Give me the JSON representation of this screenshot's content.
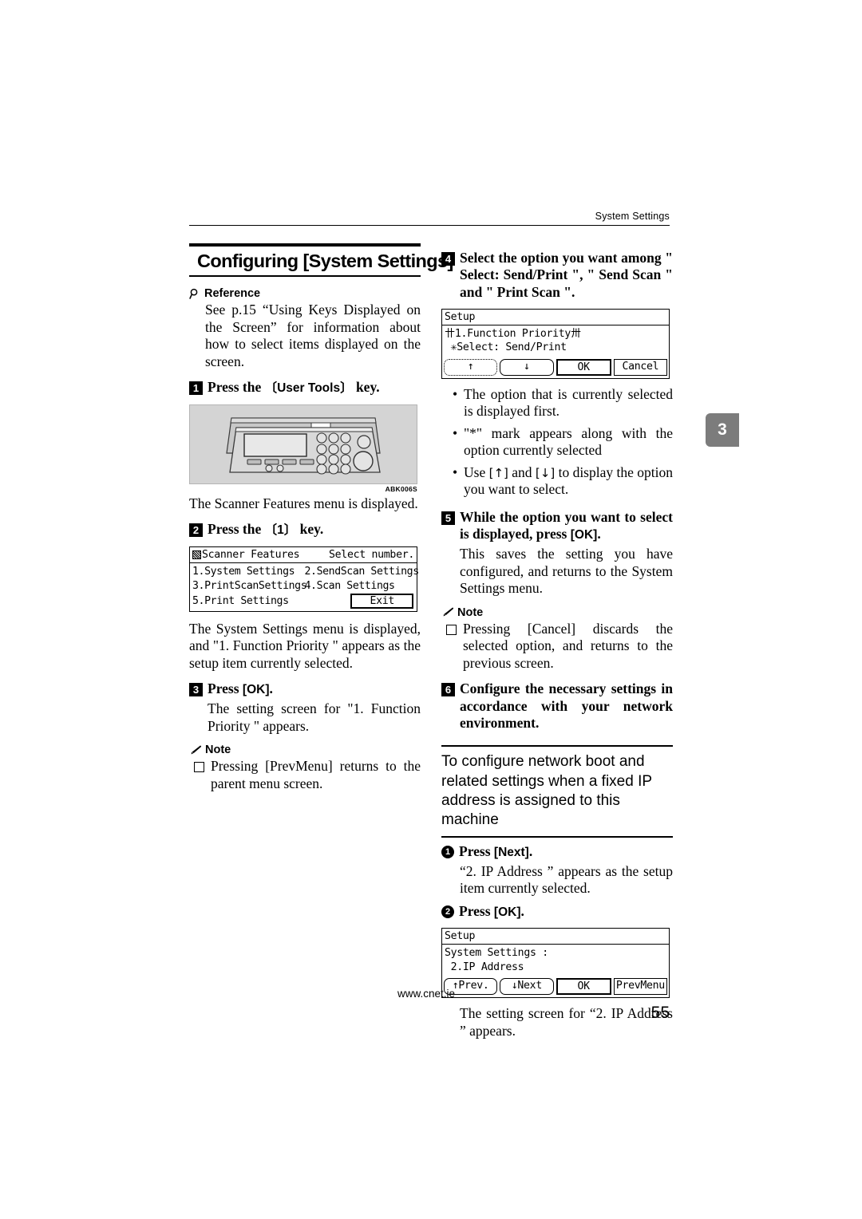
{
  "header": {
    "running_title": "System Settings"
  },
  "chapter_tab": {
    "number": "3"
  },
  "section": {
    "title": "Configuring [System Settings]"
  },
  "reference": {
    "heading": "Reference",
    "body": "See p.15 “Using Keys Displayed on the Screen” for information about how to select items displayed on the screen."
  },
  "steps": {
    "s1": {
      "num": "1",
      "text_before": "Press the ",
      "key": "〔User Tools〕",
      "text_after": " key."
    },
    "s1_body": "The Scanner Features menu is displayed.",
    "s2": {
      "num": "2",
      "text_before": "Press the ",
      "key": "〔1〕",
      "text_after": " key."
    },
    "s2_body": "The System Settings menu is displayed, and \"1. Function Priority \" appears as the setup item currently selected.",
    "s3": {
      "num": "3",
      "text_before": "Press ",
      "key": "[OK]",
      "text_after": "."
    },
    "s3_body": "The setting screen for \"1. Function Priority \" appears.",
    "s4": {
      "num": "4",
      "text": "Select the option you want among \" Select: Send/Print \", \" Send Scan \" and \" Print Scan \"."
    },
    "s5": {
      "num": "5",
      "text_before": "While the option you want to select is displayed, press ",
      "key": "[OK]",
      "text_after": "."
    },
    "s5_body": "This saves the setting you have configured, and returns to the System Settings menu.",
    "s6": {
      "num": "6",
      "text": "Configure the necessary settings in accordance with your network environment."
    }
  },
  "note_left": {
    "heading": "Note",
    "items": [
      {
        "text_before": "Pressing ",
        "key": "[PrevMenu]",
        "text_after": " returns to the parent menu screen."
      }
    ]
  },
  "note_right": {
    "heading": "Note",
    "items": [
      {
        "text_before": "Pressing ",
        "key": "[Cancel]",
        "text_after": " discards the selected option, and returns to the previous screen."
      }
    ]
  },
  "bullets": [
    "The option that is currently selected is displayed first.",
    "\"*\" mark appears along with the option currently selected",
    {
      "before": "Use ",
      "key1": "[↑]",
      "mid": " and ",
      "key2": "[↓]",
      "after": " to display the option you want to select."
    }
  ],
  "subsection": {
    "title": "To configure network boot and related settings when a fixed IP address is assigned to this machine"
  },
  "substeps": {
    "a": {
      "num": "1",
      "text_before": "Press ",
      "key": "[Next]",
      "text_after": "."
    },
    "a_body": "“2. IP Address ” appears as the setup item currently selected.",
    "b": {
      "num": "2",
      "text_before": "Press ",
      "key": "[OK]",
      "text_after": "."
    },
    "b_body": "The setting screen for “2. IP Address ” appears."
  },
  "lcd_scanner_features": {
    "title_icon": "menu-icon",
    "title": "Scanner Features",
    "title_right": "Select number.",
    "rows": [
      [
        "1.System Settings",
        "2.SendScan Settings"
      ],
      [
        "3.PrintScanSettings",
        "4.Scan Settings"
      ]
    ],
    "last_row_label": "5.Print Settings",
    "exit_button": "Exit"
  },
  "lcd_setup_priority": {
    "title": "Setup",
    "line1": "〹1.Function Priority〺",
    "line2": " ✳Select: Send/Print",
    "buttons": [
      "↑",
      "↓",
      "OK",
      "Cancel"
    ]
  },
  "lcd_setup_ip": {
    "title": "Setup",
    "line1": "System Settings :",
    "line2": " 2.IP Address",
    "buttons": [
      "↑Prev.",
      "↓Next",
      "OK",
      "PrevMenu"
    ]
  },
  "illustration": {
    "caption": "ABK006S",
    "alt": "machine control panel"
  },
  "footer": {
    "url": "www.cnet.ie",
    "page_number": "55"
  }
}
